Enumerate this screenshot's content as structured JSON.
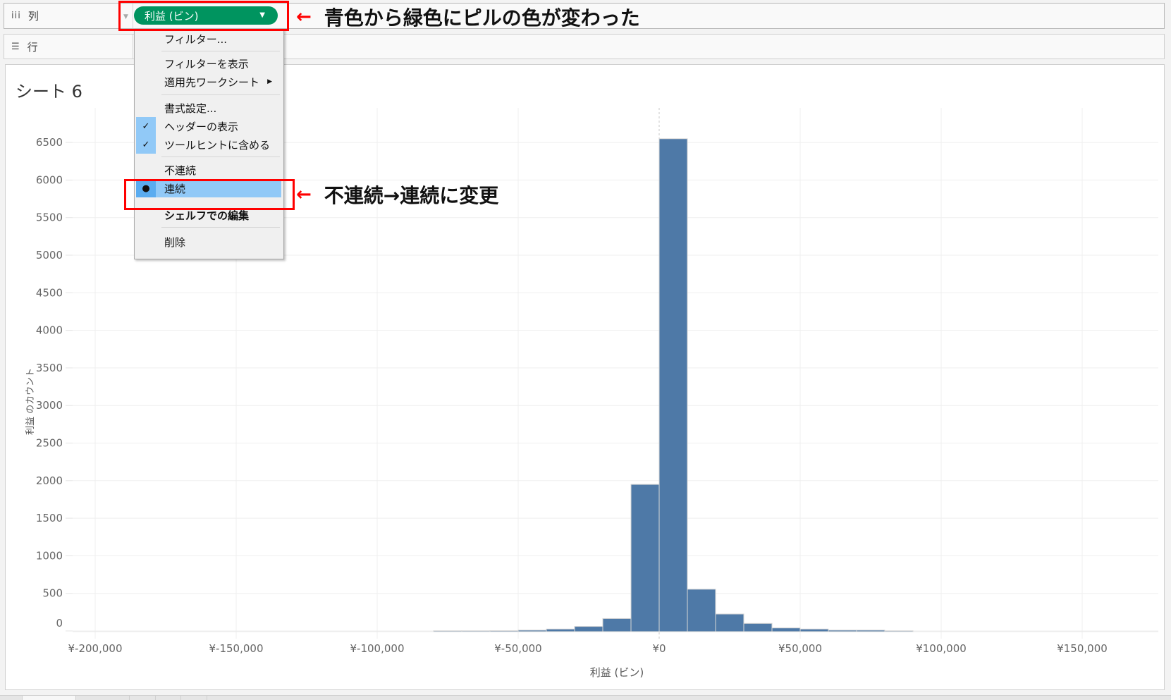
{
  "shelves": {
    "columns": {
      "icon": "columns-icon",
      "label": "列",
      "pill_label": "利益 (ビン)",
      "pill_color": "#00945f"
    },
    "rows": {
      "icon": "rows-icon",
      "label": "行"
    }
  },
  "context_menu": {
    "items": [
      {
        "label": "フィルター...",
        "checked": false
      },
      {
        "label": "フィルターを表示",
        "checked": false
      },
      {
        "label": "適用先ワークシート",
        "submenu": true
      },
      {
        "label": "書式設定...",
        "checked": false
      },
      {
        "label": "ヘッダーの表示",
        "checked": true
      },
      {
        "label": "ツールヒントに含める",
        "checked": true
      },
      {
        "label": "不連続",
        "radio": false
      },
      {
        "label": "連続",
        "radio": true,
        "highlighted": true
      },
      {
        "label": "シェルフでの編集",
        "bold": true
      },
      {
        "label": "削除"
      }
    ]
  },
  "annotations": {
    "pill_note": "青色から緑色にピルの色が変わった",
    "menu_note": "不連続→連続に変更",
    "arrow": "←"
  },
  "sheet": {
    "title": "シート 6"
  },
  "colors": {
    "bar": "#4e79a7",
    "highlight_box": "#ff0000",
    "menu_selected": "#91c9f7"
  },
  "chart_data": {
    "type": "bar",
    "title": "シート 6",
    "xlabel": "利益 (ビン)",
    "ylabel": "利益 のカウント",
    "bin_size": 10000,
    "bins": [
      {
        "start": -80000,
        "count": 2
      },
      {
        "start": -70000,
        "count": 2
      },
      {
        "start": -60000,
        "count": 3
      },
      {
        "start": -50000,
        "count": 10
      },
      {
        "start": -40000,
        "count": 25
      },
      {
        "start": -30000,
        "count": 60
      },
      {
        "start": -20000,
        "count": 165
      },
      {
        "start": -10000,
        "count": 1950
      },
      {
        "start": 0,
        "count": 6550
      },
      {
        "start": 10000,
        "count": 555
      },
      {
        "start": 20000,
        "count": 225
      },
      {
        "start": 30000,
        "count": 100
      },
      {
        "start": 40000,
        "count": 40
      },
      {
        "start": 50000,
        "count": 25
      },
      {
        "start": 60000,
        "count": 10
      },
      {
        "start": 70000,
        "count": 10
      },
      {
        "start": 80000,
        "count": 2
      }
    ],
    "x_ticks": [
      -200000,
      -150000,
      -100000,
      -50000,
      0,
      50000,
      100000,
      150000
    ],
    "x_tick_labels": [
      "¥-200,000",
      "¥-150,000",
      "¥-100,000",
      "¥-50,000",
      "¥0",
      "¥50,000",
      "¥100,000",
      "¥150,000"
    ],
    "y_ticks": [
      0,
      500,
      1000,
      1500,
      2000,
      2500,
      3000,
      3500,
      4000,
      4500,
      5000,
      5500,
      6000,
      6500
    ],
    "y_tick_labels": [
      "0",
      "500",
      "1000",
      "1500",
      "2000",
      "2500",
      "3000",
      "3500",
      "4000",
      "4500",
      "5000",
      "5500",
      "6000",
      "6500"
    ],
    "xlim": [
      -225000,
      177000
    ],
    "ylim": [
      0,
      6900
    ],
    "grid": true
  }
}
